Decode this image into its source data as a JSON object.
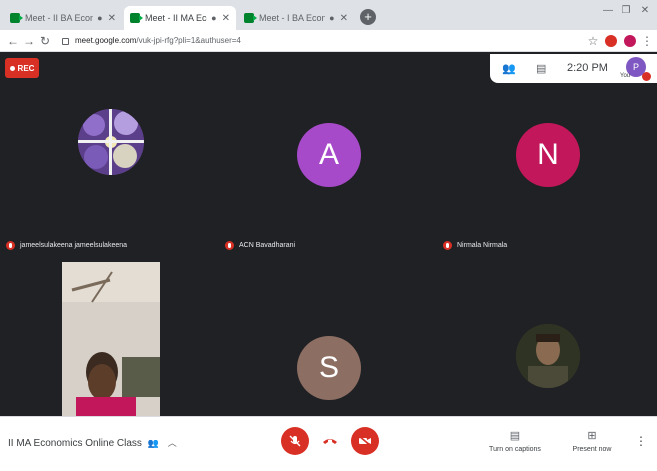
{
  "browser": {
    "tabs": [
      {
        "title": "Meet - II BA Economics Onl",
        "active": false
      },
      {
        "title": "Meet - II MA Economics Onl",
        "active": true
      },
      {
        "title": "Meet - I BA Economics Onl",
        "active": false
      }
    ],
    "new_tab_glyph": "+",
    "url_host": "meet.google.com",
    "url_path": "/vuk-jpi-rfg?pli=1&authuser=4"
  },
  "meet": {
    "rec_label": "REC",
    "clock": "2:20 PM",
    "you_label": "You",
    "you_initial": "P",
    "participants": [
      {
        "name": "jameelsulakeena jameelsulakeena",
        "initial": "",
        "color": "#6a4c93",
        "type": "photo"
      },
      {
        "name": "ACN Bavadharani",
        "initial": "A",
        "color": "#a64ac9",
        "type": "initial"
      },
      {
        "name": "Nirmala Nirmala",
        "initial": "N",
        "color": "#c2185b",
        "type": "initial"
      },
      {
        "name": "",
        "initial": "",
        "color": "#5b4a3a",
        "type": "video"
      },
      {
        "name": "",
        "initial": "S",
        "color": "#8d6e63",
        "type": "initial"
      },
      {
        "name": "",
        "initial": "",
        "color": "#3b3b2e",
        "type": "photo"
      }
    ],
    "meeting_name": "II MA Economics Online Class",
    "captions_label": "Turn on captions",
    "present_label": "Present now"
  },
  "colors": {
    "stage_bg": "#202124",
    "danger": "#d93025"
  }
}
